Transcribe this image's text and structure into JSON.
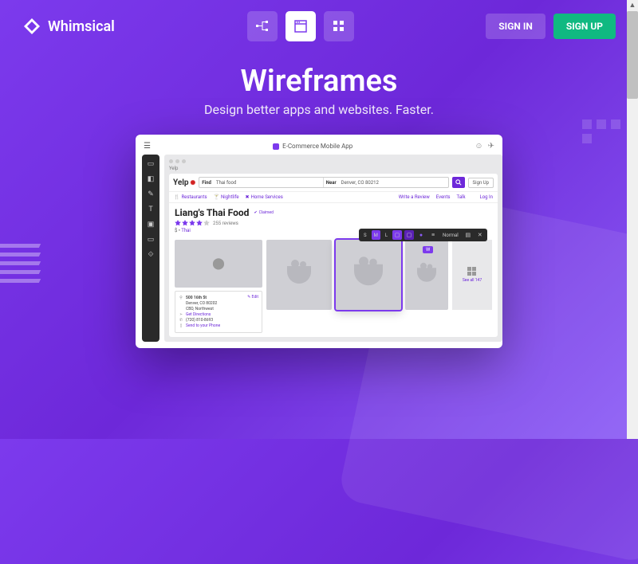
{
  "brand": "Whimsical",
  "auth": {
    "signin": "SIGN IN",
    "signup": "SIGN UP"
  },
  "hero": {
    "title": "Wireframes",
    "subtitle": "Design better apps and websites. Faster."
  },
  "doc_title": "E-Commerce Mobile App",
  "canvas_label": "Yelp",
  "yelp": {
    "logo": "Yelp",
    "find_label": "Find",
    "find_value": "Thai food",
    "near_label": "Near",
    "near_value": "Denver, CO 80212",
    "signup": "Sign Up",
    "login": "Log In",
    "cats": {
      "restaurants": "Restaurants",
      "nightlife": "Nightlife",
      "home": "Home Services",
      "write": "Write a Review",
      "events": "Events",
      "talk": "Talk"
    },
    "biz": {
      "name": "Liang's Thai Food",
      "claimed": "Claimed",
      "reviews": "255 reviews",
      "price": "$",
      "dot": "•",
      "cuisine": "Thai"
    },
    "info": {
      "address1": "500 16th St",
      "address2": "Denver, CO 80202",
      "address3": "CBD, Northwest",
      "directions": "Get Directions",
      "phone": "(720) 810-8693",
      "send_phone": "Send to your Phone",
      "edit": "Edit"
    },
    "see_all": "See all 147"
  },
  "toolbar": {
    "s": "S",
    "m": "M",
    "l": "L",
    "normal": "Normal"
  },
  "cursor_user": "W"
}
